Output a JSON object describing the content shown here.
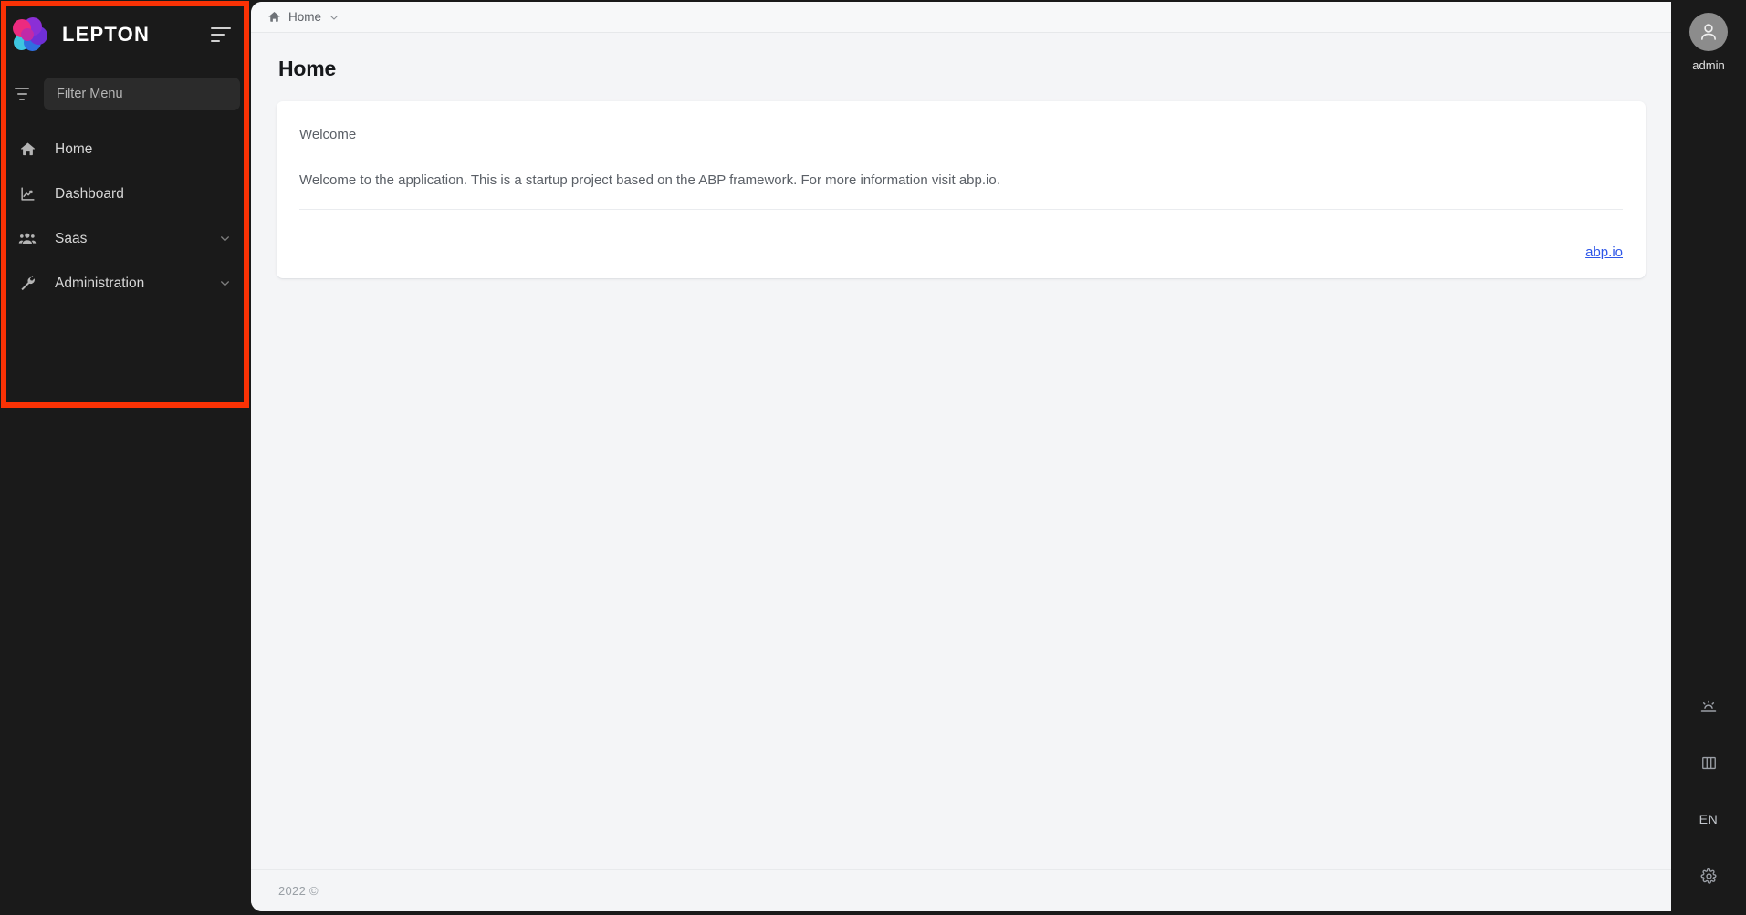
{
  "app": {
    "brand": "LEPTON",
    "background_color": "#1a1a1a",
    "panel_color": "#f4f5f7",
    "accent_link_color": "#2d56e8",
    "annotation_color": "#fa3205"
  },
  "sidebar": {
    "brand_label": "LEPTON",
    "collapse_toggle_name": "menu-collapse-toggle",
    "filter": {
      "icon": "filter-icon",
      "placeholder": "Filter Menu",
      "value": ""
    },
    "items": [
      {
        "label": "Home",
        "icon": "home-icon",
        "has_children": false,
        "active": false
      },
      {
        "label": "Dashboard",
        "icon": "chart-line-icon",
        "has_children": false,
        "active": false
      },
      {
        "label": "Saas",
        "icon": "users-icon",
        "has_children": true,
        "active": false
      },
      {
        "label": "Administration",
        "icon": "wrench-icon",
        "has_children": true,
        "active": false
      }
    ]
  },
  "topbar": {
    "breadcrumb": {
      "home_icon": "home-icon",
      "label": "Home",
      "caret_icon": "chevron-down-icon"
    }
  },
  "main": {
    "page_title": "Home",
    "card": {
      "subtitle": "Welcome",
      "body_text": "Welcome to the application. This is a startup project based on the ABP framework. For more information visit abp.io.",
      "link_label": "abp.io"
    }
  },
  "footer": {
    "copyright": "2022 ©"
  },
  "right_rail": {
    "user": {
      "avatar_icon": "user-avatar-icon",
      "name": "admin"
    },
    "actions": [
      {
        "name": "brightness-icon",
        "label": ""
      },
      {
        "name": "layout-columns-icon",
        "label": ""
      },
      {
        "name": "language-selector",
        "label": "EN"
      },
      {
        "name": "gear-icon",
        "label": ""
      }
    ]
  }
}
